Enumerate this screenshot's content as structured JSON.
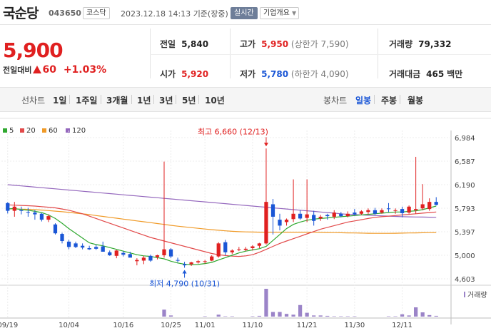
{
  "stock": {
    "name": "국순당",
    "code": "043650",
    "market": "코스닥",
    "datetime": "2023.12.18 14:13",
    "basis": "기준(장중)",
    "realtime_label": "실시간",
    "company_info_label": "기업개요",
    "price": "5,900",
    "change_label": "전일대비",
    "change": "60",
    "change_pct": "+1.03%"
  },
  "summary": {
    "prev_label": "전일",
    "prev": "5,840",
    "high_label": "고가",
    "high": "5,950",
    "upper_limit": "(상한가 7,590)",
    "volume_label": "거래량",
    "volume": "79,332",
    "open_label": "시가",
    "open": "5,920",
    "low_label": "저가",
    "low": "5,780",
    "lower_limit": "(하한가 4,090)",
    "amount_label": "거래대금",
    "amount": "465",
    "amount_unit": "백만"
  },
  "ranges": {
    "line_label": "선차트",
    "line_items": [
      "1일",
      "1주일",
      "3개월",
      "1년",
      "3년",
      "5년",
      "10년"
    ],
    "candle_label": "봉차트",
    "candle_items": [
      "일봉",
      "주봉",
      "월봉"
    ],
    "candle_selected": "일봉"
  },
  "colors": {
    "up": "#e02020",
    "down": "#1a56d6",
    "ma5": "#2fa82f",
    "ma20": "#e24a4a",
    "ma60": "#f09a27",
    "ma120": "#9467bd",
    "volume": "#9b84c8"
  },
  "chart_data": {
    "type": "candlestick",
    "legend": [
      {
        "name": "5",
        "color": "#2fa82f"
      },
      {
        "name": "20",
        "color": "#e24a4a"
      },
      {
        "name": "60",
        "color": "#f09a27"
      },
      {
        "name": "120",
        "color": "#9467bd"
      }
    ],
    "y_ticks": [
      "6,984",
      "6,587",
      "6,190",
      "5,793",
      "5,397",
      "5,000",
      "4,603"
    ],
    "ylim": [
      4603,
      6984
    ],
    "x_ticks": [
      "09/19",
      "10/04",
      "10/16",
      "10/25",
      "11/01",
      "11/10",
      "11/21",
      "11/30",
      "12/11"
    ],
    "x_tick_index": [
      0,
      9,
      17,
      24,
      29,
      36,
      44,
      51,
      58
    ],
    "high_annotation": "최고 6,660 (12/13)",
    "low_annotation": "최저 4,790 (10/31)",
    "volume_label": "거래량",
    "candles": [
      [
        5880,
        5895,
        5705,
        5750
      ],
      [
        5750,
        5900,
        5650,
        5820
      ],
      [
        5760,
        5820,
        5690,
        5750
      ],
      [
        5730,
        5800,
        5650,
        5720
      ],
      [
        5720,
        5760,
        5600,
        5690
      ],
      [
        5700,
        5710,
        5570,
        5600
      ],
      [
        5600,
        5690,
        5560,
        5660
      ],
      [
        5520,
        5540,
        5350,
        5370
      ],
      [
        5360,
        5380,
        5200,
        5240
      ],
      [
        5230,
        5260,
        5100,
        5140
      ],
      [
        5200,
        5230,
        5120,
        5140
      ],
      [
        5160,
        5200,
        5100,
        5130
      ],
      [
        5120,
        5160,
        5090,
        5100
      ],
      [
        5140,
        5180,
        5090,
        5110
      ],
      [
        5150,
        5230,
        5080,
        5060
      ],
      [
        5050,
        5080,
        4990,
        5000
      ],
      [
        4990,
        5090,
        4950,
        5080
      ],
      [
        5040,
        5070,
        4980,
        5010
      ],
      [
        5020,
        5060,
        4970,
        4960
      ],
      [
        4900,
        4950,
        4830,
        4920
      ],
      [
        4910,
        4990,
        4850,
        4960
      ],
      [
        4990,
        5010,
        4890,
        4910
      ],
      [
        4970,
        5010,
        4930,
        5000
      ],
      [
        5000,
        6580,
        4960,
        5100
      ],
      [
        5100,
        5120,
        4950,
        4980
      ],
      [
        4920,
        4960,
        4880,
        4910
      ],
      [
        4850,
        4890,
        4790,
        4830
      ],
      [
        4850,
        4890,
        4820,
        4880
      ],
      [
        4880,
        4920,
        4860,
        4900
      ],
      [
        4890,
        4920,
        4860,
        4900
      ],
      [
        4910,
        5000,
        4900,
        4980
      ],
      [
        4980,
        5220,
        4960,
        5200
      ],
      [
        5220,
        5260,
        5000,
        5050
      ],
      [
        5050,
        5100,
        5020,
        5080
      ],
      [
        5090,
        5140,
        5070,
        5100
      ],
      [
        5090,
        5140,
        5070,
        5110
      ],
      [
        5120,
        5170,
        5080,
        5150
      ],
      [
        5160,
        5210,
        5120,
        5200
      ],
      [
        5200,
        6800,
        5180,
        5900
      ],
      [
        5860,
        5950,
        5350,
        5650
      ],
      [
        5600,
        5700,
        5420,
        5500
      ],
      [
        5560,
        5620,
        5500,
        5600
      ],
      [
        5610,
        6280,
        5560,
        5700
      ],
      [
        5700,
        5760,
        5600,
        5620
      ],
      [
        5630,
        6280,
        5560,
        5690
      ],
      [
        5680,
        5750,
        5500,
        5580
      ],
      [
        5620,
        5680,
        5580,
        5650
      ],
      [
        5680,
        5700,
        5600,
        5660
      ],
      [
        5650,
        5760,
        5610,
        5720
      ],
      [
        5700,
        5730,
        5640,
        5660
      ],
      [
        5660,
        5740,
        5640,
        5700
      ],
      [
        5720,
        5780,
        5670,
        5690
      ],
      [
        5700,
        5760,
        5680,
        5740
      ],
      [
        5730,
        5790,
        5690,
        5760
      ],
      [
        5760,
        5800,
        5680,
        5700
      ],
      [
        5720,
        5790,
        5700,
        5760
      ],
      [
        5790,
        5880,
        5730,
        5780
      ],
      [
        5750,
        5790,
        5700,
        5760
      ],
      [
        5780,
        5820,
        5640,
        5710
      ],
      [
        5720,
        5840,
        5700,
        5820
      ],
      [
        5760,
        6660,
        5700,
        5780
      ],
      [
        5790,
        6200,
        5760,
        5860
      ],
      [
        5780,
        5960,
        5750,
        5900
      ],
      [
        5900,
        5980,
        5840,
        5850
      ]
    ],
    "volumes": [
      0,
      0,
      0,
      0,
      0,
      0,
      0,
      0,
      0,
      0,
      0,
      0,
      0,
      0,
      0,
      0,
      0,
      0,
      0,
      0,
      0,
      0,
      0,
      0.9,
      0.15,
      0,
      0,
      0,
      0,
      0.05,
      0,
      0.25,
      0.05,
      0.05,
      0,
      0,
      0.05,
      0.1,
      3.6,
      0.6,
      0.6,
      0.35,
      0.25,
      1.5,
      0.5,
      0.15,
      0.15,
      0.1,
      0.05,
      0.05,
      0.05,
      0.05,
      0,
      0,
      0,
      0,
      0.05,
      0.05,
      0.3,
      0.15,
      1.2,
      0.55,
      0.2,
      0.1
    ],
    "ma5": [
      5780,
      5790,
      5770,
      5760,
      5740,
      5720,
      5680,
      5620,
      5540,
      5450,
      5370,
      5290,
      5210,
      5180,
      5160,
      5130,
      5100,
      5070,
      5040,
      5010,
      4990,
      4980,
      4960,
      4940,
      4900,
      4870,
      4850,
      4840,
      4845,
      4860,
      4880,
      4920,
      4960,
      5000,
      5040,
      5070,
      5090,
      5110,
      5150,
      5250,
      5350,
      5450,
      5520,
      5560,
      5590,
      5610,
      5620,
      5630,
      5640,
      5650,
      5660,
      5670,
      5680,
      5690,
      5700,
      5710,
      5720,
      5730,
      5730,
      5740,
      5750,
      5770,
      5800,
      5830
    ],
    "ma20": [
      5850,
      5845,
      5840,
      5835,
      5830,
      5820,
      5810,
      5800,
      5780,
      5760,
      5730,
      5700,
      5660,
      5620,
      5580,
      5540,
      5500,
      5460,
      5420,
      5380,
      5340,
      5300,
      5270,
      5240,
      5210,
      5180,
      5150,
      5120,
      5090,
      5060,
      5030,
      5010,
      4995,
      4985,
      4980,
      4990,
      5010,
      5050,
      5100,
      5150,
      5200,
      5240,
      5280,
      5320,
      5360,
      5400,
      5440,
      5470,
      5500,
      5530,
      5560,
      5580,
      5600,
      5620,
      5640,
      5650,
      5660,
      5670,
      5680,
      5690,
      5700,
      5710,
      5720,
      5730
    ],
    "ma60": [
      5785,
      5782,
      5778,
      5774,
      5770,
      5762,
      5754,
      5744,
      5734,
      5722,
      5710,
      5698,
      5686,
      5670,
      5655,
      5640,
      5625,
      5610,
      5595,
      5580,
      5565,
      5550,
      5535,
      5520,
      5505,
      5490,
      5478,
      5466,
      5454,
      5442,
      5432,
      5422,
      5412,
      5404,
      5398,
      5394,
      5392,
      5390,
      5390,
      5390,
      5390,
      5390,
      5390,
      5390,
      5390,
      5388,
      5386,
      5384,
      5382,
      5380,
      5378,
      5376,
      5374,
      5372,
      5370,
      5370,
      5370,
      5372,
      5374,
      5376,
      5378,
      5380,
      5382,
      5384
    ],
    "ma120": [
      6190,
      6180,
      6170,
      6160,
      6150,
      6140,
      6130,
      6120,
      6110,
      6100,
      6090,
      6080,
      6070,
      6060,
      6050,
      6040,
      6030,
      6020,
      6010,
      6000,
      5990,
      5980,
      5970,
      5960,
      5950,
      5940,
      5930,
      5920,
      5910,
      5900,
      5890,
      5880,
      5870,
      5860,
      5850,
      5840,
      5830,
      5820,
      5810,
      5800,
      5790,
      5780,
      5770,
      5760,
      5750,
      5740,
      5730,
      5720,
      5710,
      5700,
      5690,
      5685,
      5680,
      5675,
      5670,
      5665,
      5660,
      5655,
      5650,
      5648,
      5646,
      5644,
      5642,
      5640
    ]
  }
}
